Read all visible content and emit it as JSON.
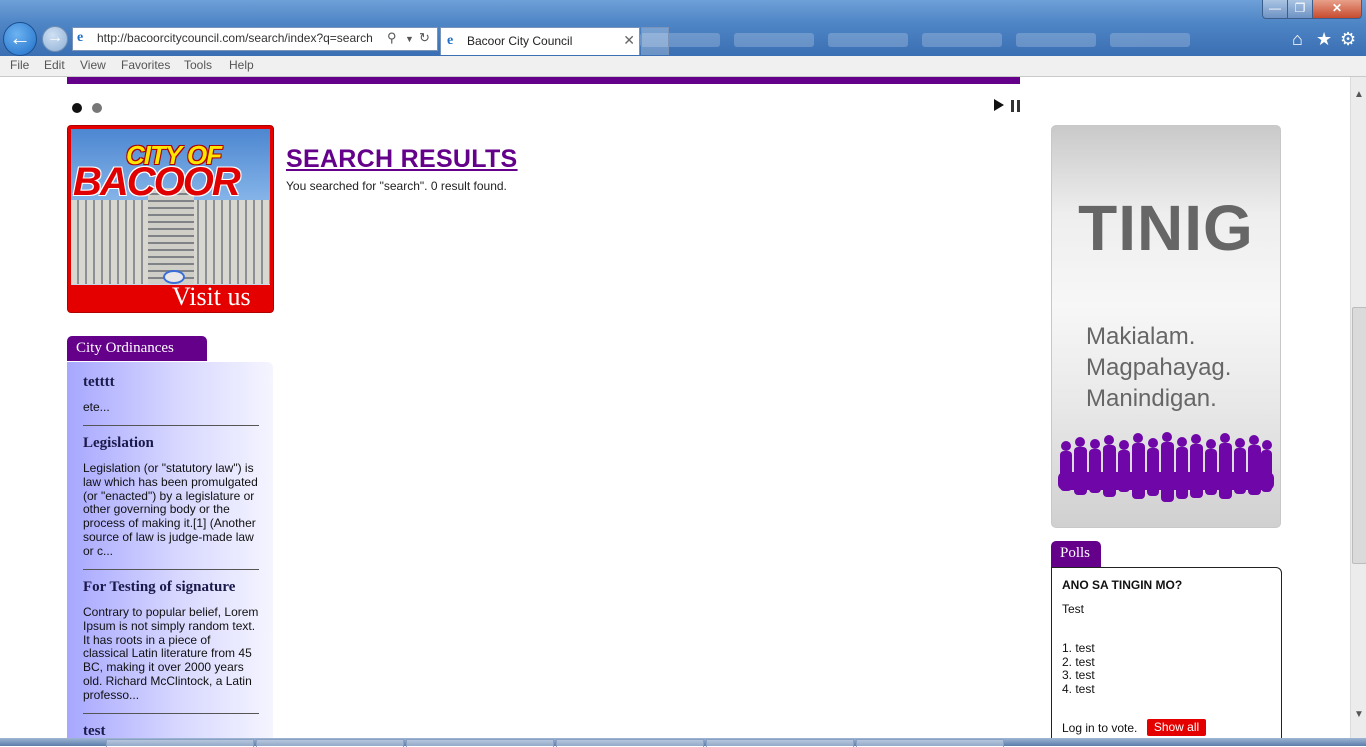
{
  "browser": {
    "address_url": "http://bacoorcitycouncil.com/search/index?q=search",
    "tab_title": "Bacoor City Council",
    "menu": [
      "File",
      "Edit",
      "View",
      "Favorites",
      "Tools",
      "Help"
    ],
    "icons": {
      "back": "back-arrow-icon",
      "forward": "forward-arrow-icon",
      "search": "search-icon",
      "dropdown": "chevron-down-icon",
      "refresh": "refresh-icon",
      "home": "home-icon",
      "favorites": "star-icon",
      "tools": "gear-icon",
      "close_tab": "close-icon"
    }
  },
  "slider": {
    "dots": 2,
    "active_dot": 1,
    "controls": [
      "play-icon",
      "pause-icon"
    ]
  },
  "banner": {
    "city_of": "CITY OF",
    "bacoor": "BACOOR",
    "visit_us": "Visit us"
  },
  "search": {
    "title": "SEARCH RESULTS",
    "summary": "You searched for \"search\". 0 result found."
  },
  "ordinances": {
    "tab_label": "City Ordinances",
    "items": [
      {
        "title": "tetttt",
        "excerpt": "ete..."
      },
      {
        "title": "Legislation",
        "excerpt": "Legislation (or \"statutory law\") is law which has been promulgated (or \"enacted\") by a legislature or other governing body or the process of making it.[1] (Another source of law is judge-made law or c..."
      },
      {
        "title": "For Testing of signature",
        "excerpt": "Contrary to popular belief, Lorem Ipsum is not simply random text. It has roots in a piece of classical Latin literature from 45 BC, making it over 2000 years old. Richard McClintock, a Latin professo..."
      },
      {
        "title": "test",
        "excerpt": ""
      }
    ]
  },
  "tinig": {
    "title": "TINIG",
    "slogan": [
      "Makialam.",
      "Magpahayag.",
      "Manindigan."
    ]
  },
  "polls": {
    "tab_label": "Polls",
    "question": "ANO SA TINGIN MO?",
    "subtitle": "Test",
    "options": [
      "1. test",
      "2. test",
      "3. test",
      "4. test"
    ],
    "login_text": "Log in to vote.",
    "show_all": "Show all"
  },
  "colors": {
    "brand_purple": "#64008a",
    "accent_red": "#e50000",
    "panel_lavender": "#a7a7ff"
  }
}
